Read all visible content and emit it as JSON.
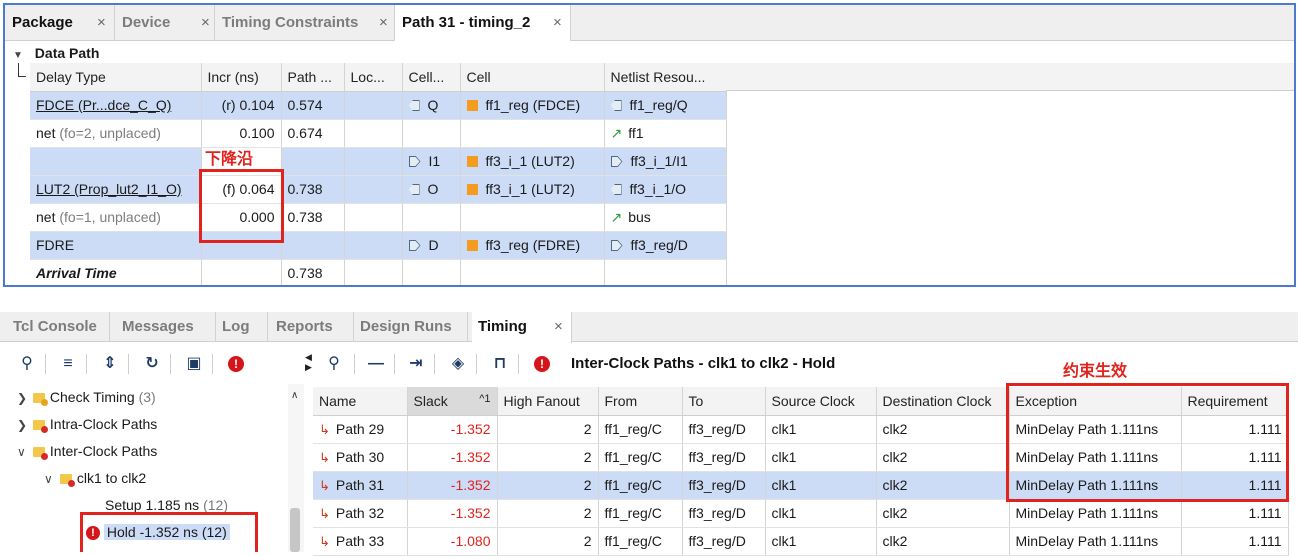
{
  "top_tabs": [
    {
      "label": "Package",
      "active": true
    },
    {
      "label": "Device"
    },
    {
      "label": "Timing Constraints"
    },
    {
      "label": "Path 31 - timing_2",
      "active": true
    }
  ],
  "close_glyph": "×",
  "data_path": {
    "title": "Data Path",
    "columns": [
      "Delay Type",
      "Incr (ns)",
      "Path ...",
      "Loc...",
      "Cell...",
      "Cell",
      "Netlist Resou..."
    ],
    "rows": [
      {
        "delay_type": "FDCE (Pr...dce_C_Q)",
        "extra": "",
        "incr": "(r) 0.104",
        "path": "0.574",
        "loc": "",
        "pin": "Q",
        "cell": "ff1_reg (FDCE)",
        "netlist": "ff1_reg/Q"
      },
      {
        "delay_type": "net",
        "extra": "(fo=2, unplaced)",
        "incr": "0.100",
        "path": "0.674",
        "loc": "",
        "pin": "",
        "cell": "",
        "netlist": "ff1"
      },
      {
        "delay_type": "",
        "extra": "",
        "incr": "",
        "path": "",
        "loc": "",
        "pin": "I1",
        "cell": "ff3_i_1 (LUT2)",
        "netlist": "ff3_i_1/I1"
      },
      {
        "delay_type": "LUT2 (Prop_lut2_I1_O)",
        "extra": "",
        "incr": "(f) 0.064",
        "path": "0.738",
        "loc": "",
        "pin": "O",
        "cell": "ff3_i_1 (LUT2)",
        "netlist": "ff3_i_1/O"
      },
      {
        "delay_type": "net",
        "extra": "(fo=1, unplaced)",
        "incr": "0.000",
        "path": "0.738",
        "loc": "",
        "pin": "",
        "cell": "",
        "netlist": "bus"
      },
      {
        "delay_type": "FDRE",
        "extra": "",
        "incr": "",
        "path": "",
        "loc": "",
        "pin": "D",
        "cell": "ff3_reg (FDRE)",
        "netlist": "ff3_reg/D"
      },
      {
        "delay_type": "Arrival Time",
        "extra": "",
        "incr": "",
        "path": "0.738",
        "loc": "",
        "pin": "",
        "cell": "",
        "netlist": ""
      }
    ]
  },
  "annotations": {
    "falling_edge": "下降沿",
    "constraint_effective": "约束生效"
  },
  "bottom_tabs": [
    {
      "label": "Tcl Console"
    },
    {
      "label": "Messages"
    },
    {
      "label": "Log"
    },
    {
      "label": "Reports"
    },
    {
      "label": "Design Runs"
    },
    {
      "label": "Timing",
      "active": true
    }
  ],
  "toolbar_right_title": "Inter-Clock Paths - clk1 to clk2 - Hold",
  "tree": {
    "check_timing": {
      "label": "Check Timing",
      "count": "(3)"
    },
    "intra": {
      "label": "Intra-Clock Paths"
    },
    "inter": {
      "label": "Inter-Clock Paths"
    },
    "clk": {
      "label": "clk1 to clk2"
    },
    "setup": {
      "label": "Setup 1.185 ns",
      "count": "(12)"
    },
    "hold": {
      "label": "Hold -1.352 ns (12)"
    }
  },
  "timing_table": {
    "columns": [
      "Name",
      "Slack",
      "High Fanout",
      "From",
      "To",
      "Source Clock",
      "Destination Clock",
      "Exception",
      "Requirement"
    ],
    "sort_indicator": "^1",
    "rows": [
      {
        "name": "Path 29",
        "slack": "-1.352",
        "fanout": "2",
        "from": "ff1_reg/C",
        "to": "ff3_reg/D",
        "src": "clk1",
        "dst": "clk2",
        "exception": "MinDelay Path 1.111ns",
        "req": "1.111"
      },
      {
        "name": "Path 30",
        "slack": "-1.352",
        "fanout": "2",
        "from": "ff1_reg/C",
        "to": "ff3_reg/D",
        "src": "clk1",
        "dst": "clk2",
        "exception": "MinDelay Path 1.111ns",
        "req": "1.111"
      },
      {
        "name": "Path 31",
        "slack": "-1.352",
        "fanout": "2",
        "from": "ff1_reg/C",
        "to": "ff3_reg/D",
        "src": "clk1",
        "dst": "clk2",
        "exception": "MinDelay Path 1.111ns",
        "req": "1.111"
      },
      {
        "name": "Path 32",
        "slack": "-1.352",
        "fanout": "2",
        "from": "ff1_reg/C",
        "to": "ff3_reg/D",
        "src": "clk1",
        "dst": "clk2",
        "exception": "MinDelay Path 1.111ns",
        "req": "1.111"
      },
      {
        "name": "Path 33",
        "slack": "-1.080",
        "fanout": "2",
        "from": "ff1_reg/C",
        "to": "ff3_reg/D",
        "src": "clk1",
        "dst": "clk2",
        "exception": "MinDelay Path 1.111ns",
        "req": "1.111"
      }
    ]
  },
  "icons": {
    "search": "search-icon",
    "collapse": "collapse-all-icon",
    "expand": "expand-all-icon",
    "refresh": "refresh-icon",
    "save": "save-icon",
    "error": "error-icon",
    "minus": "minus-icon",
    "step": "step-into-icon",
    "diamond": "diamond-icon",
    "waveform": "waveform-icon"
  },
  "colors": {
    "accent": "#4a7bd0",
    "highlight": "#cddcf6",
    "negative": "#e0231c",
    "annotation": "#e0231c",
    "cell_icon": "#f39c20"
  }
}
